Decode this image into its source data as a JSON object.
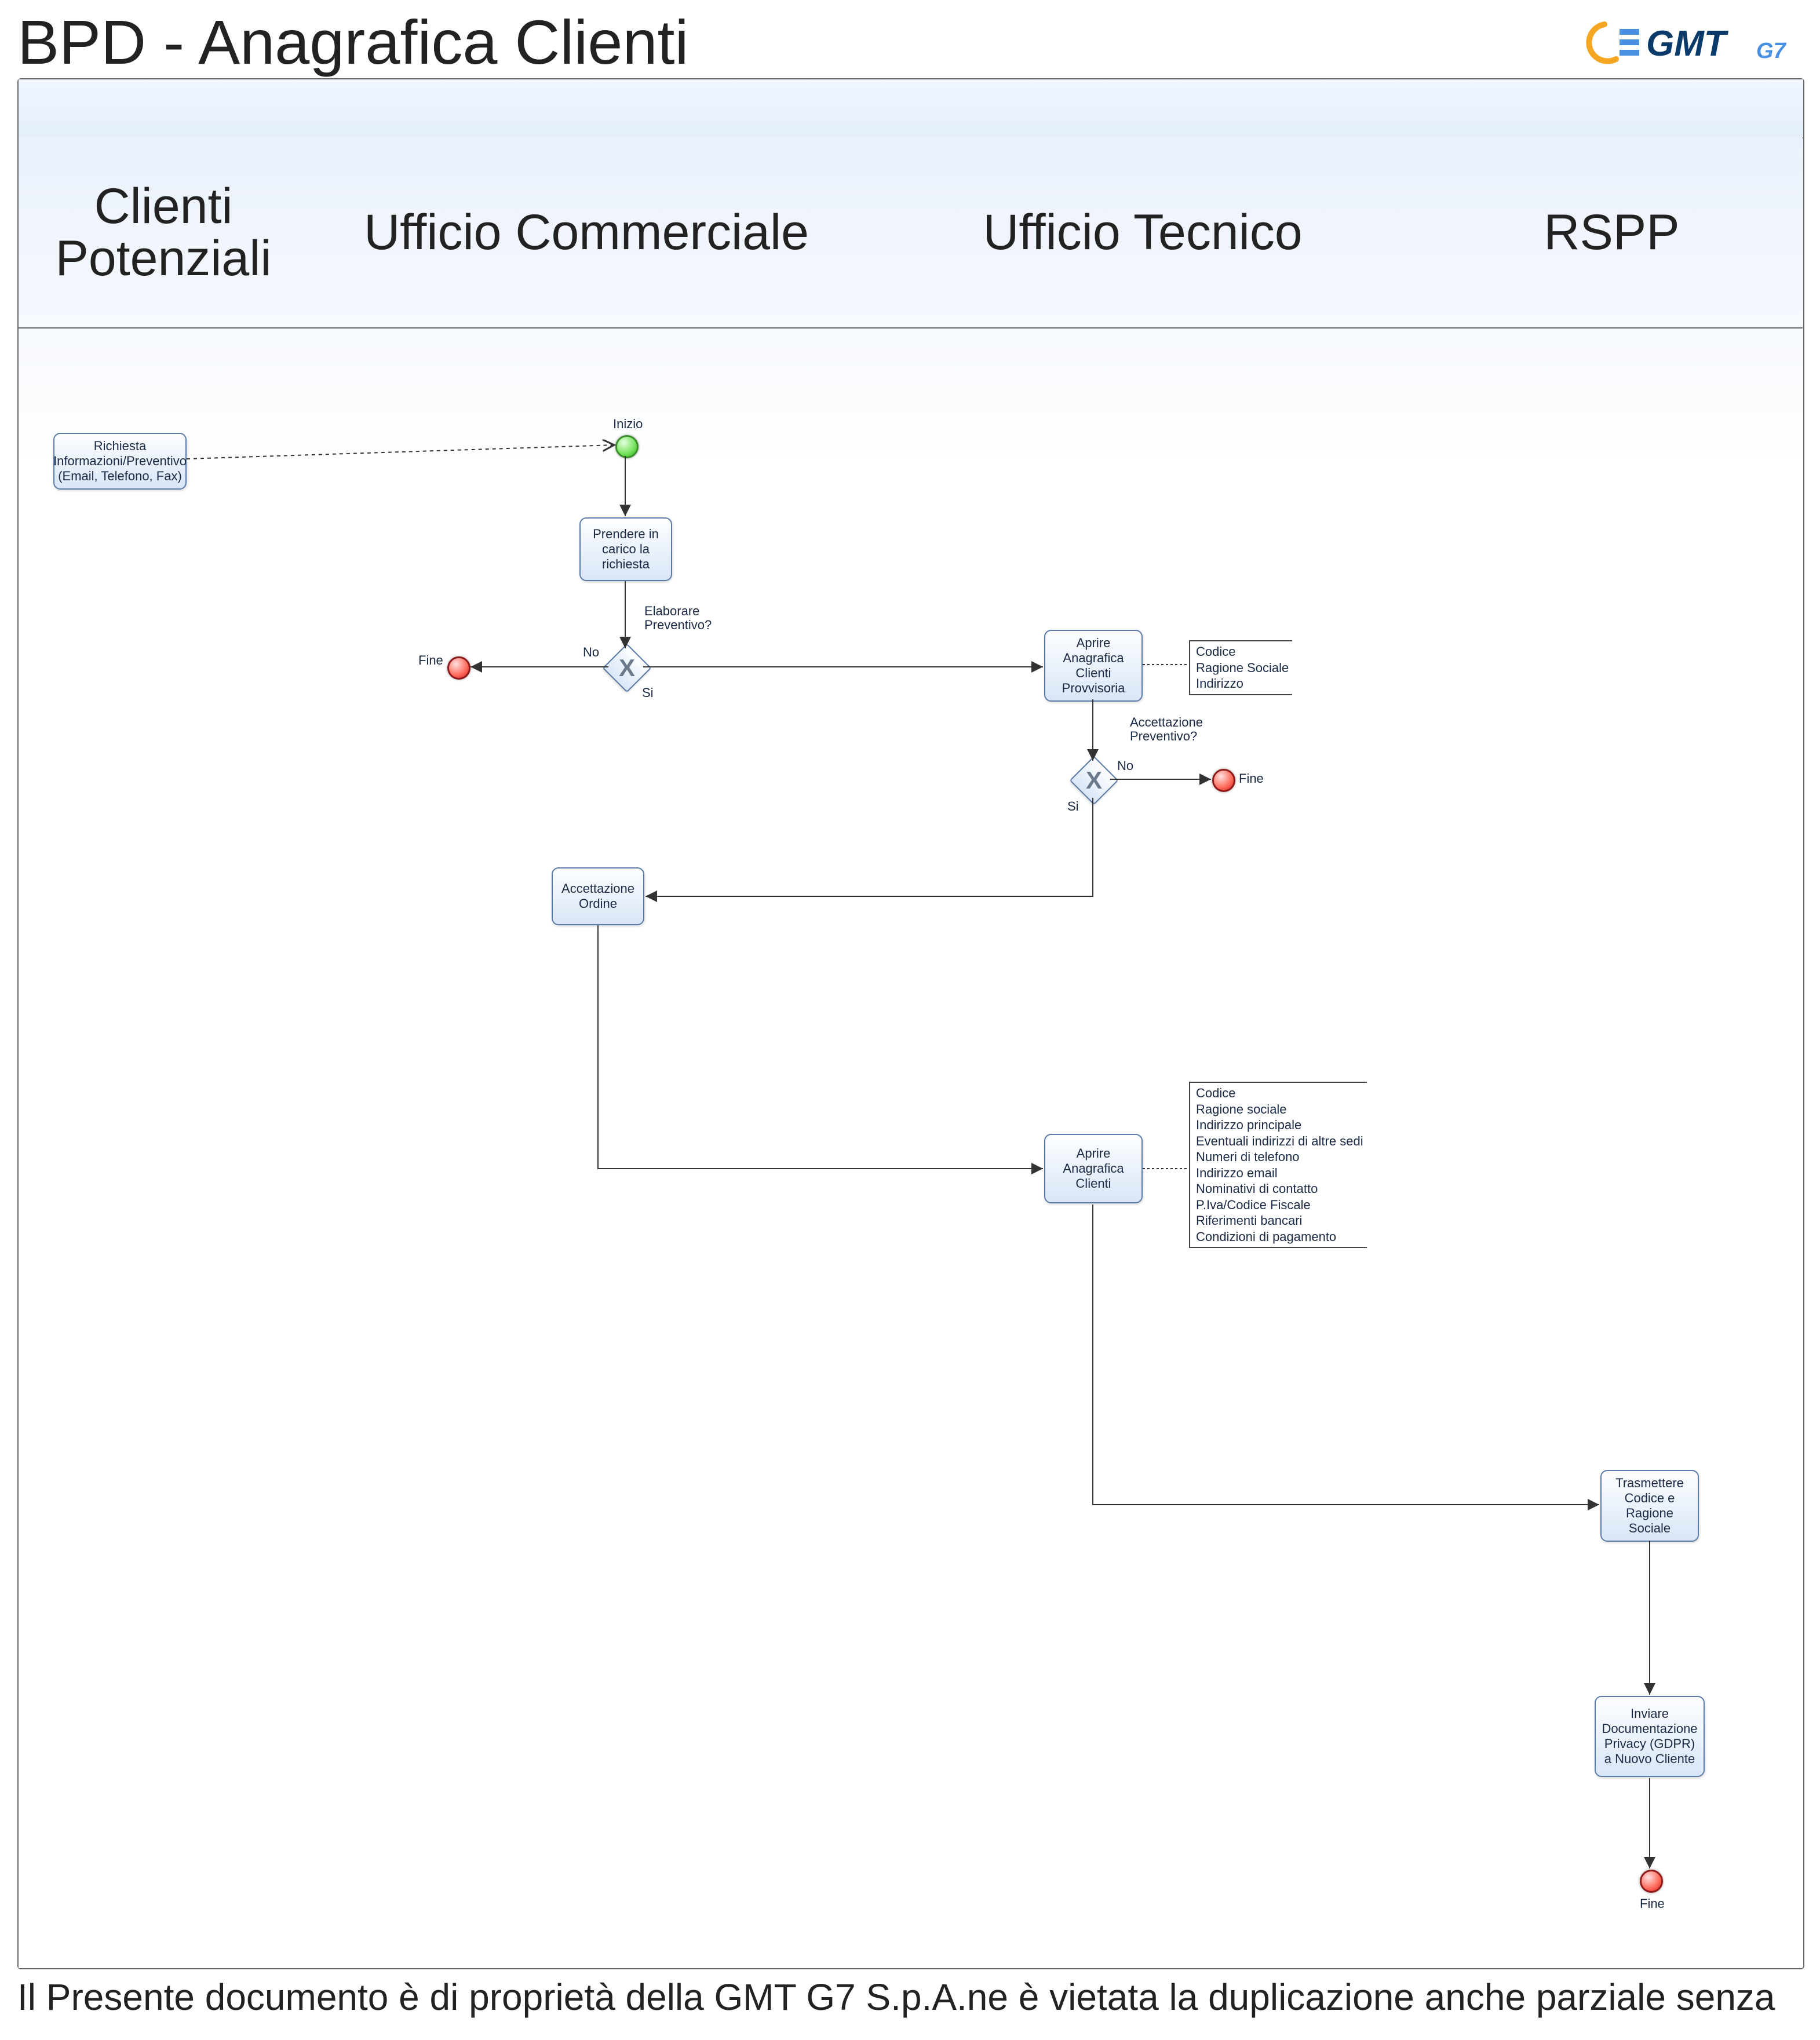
{
  "title": "BPD - Anagrafica Clienti",
  "logo_text": "GMT",
  "logo_sub": "G7",
  "lanes": {
    "l1": "Clienti Potenziali",
    "l2": "Ufficio Commerciale",
    "l3": "Ufficio Tecnico",
    "l4": "RSPP"
  },
  "events": {
    "start_label": "Inizio",
    "end_label": "Fine"
  },
  "tasks": {
    "richiesta": "Richiesta Informazioni/Preventivo (Email, Telefono, Fax)",
    "prendere": "Prendere in carico la richiesta",
    "aprire_provv": "Aprire Anagrafica Clienti Provvisoria",
    "accettazione_ordine": "Accettazione Ordine",
    "aprire_clienti": "Aprire Anagrafica Clienti",
    "trasmettere": "Trasmettere Codice e Ragione Sociale",
    "inviare_gdpr": "Inviare Documentazione Privacy (GDPR) a Nuovo Cliente"
  },
  "gateways": {
    "g1_label": "Elaborare Preventivo?",
    "g1_no": "No",
    "g1_si": "Si",
    "g2_label": "Accettazione Preventivo?",
    "g2_no": "No",
    "g2_si": "Si"
  },
  "data_objects": {
    "do1_lines": [
      "Codice",
      "Ragione Sociale",
      "Indirizzo"
    ],
    "do2_lines": [
      "Codice",
      "Ragione sociale",
      "Indirizzo principale",
      "Eventuali indirizzi di altre sedi",
      "Numeri di telefono",
      "Indirizzo email",
      "Nominativi di contatto",
      "P.Iva/Codice Fiscale",
      "Riferimenti bancari",
      "Condizioni di pagamento"
    ]
  },
  "footer": "Il Presente documento è di proprietà della GMT G7 S.p.A.ne è vietata la duplicazione anche parziale senza"
}
